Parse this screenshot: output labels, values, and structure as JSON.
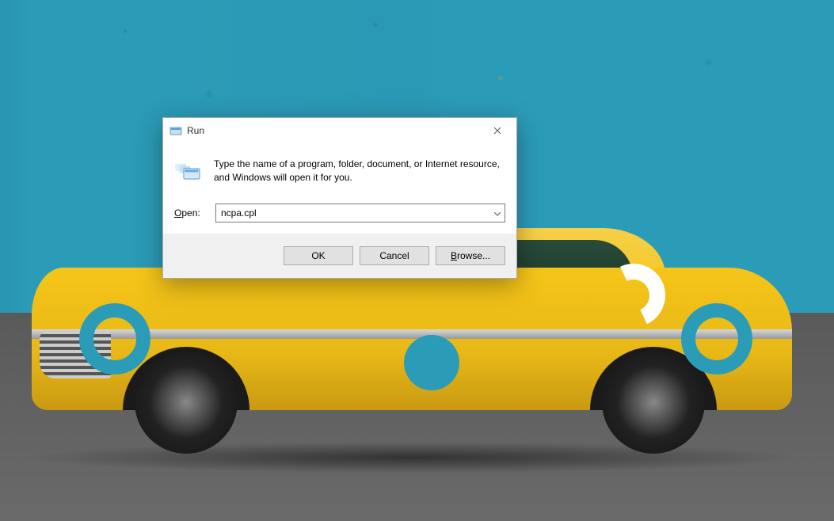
{
  "dialog": {
    "title": "Run",
    "description": "Type the name of a program, folder, document, or Internet resource, and Windows will open it for you.",
    "open_label_prefix": "O",
    "open_label_rest": "pen:",
    "input_value": "ncpa.cpl",
    "buttons": {
      "ok": "OK",
      "cancel": "Cancel",
      "browse_prefix": "B",
      "browse_rest": "rowse..."
    }
  }
}
